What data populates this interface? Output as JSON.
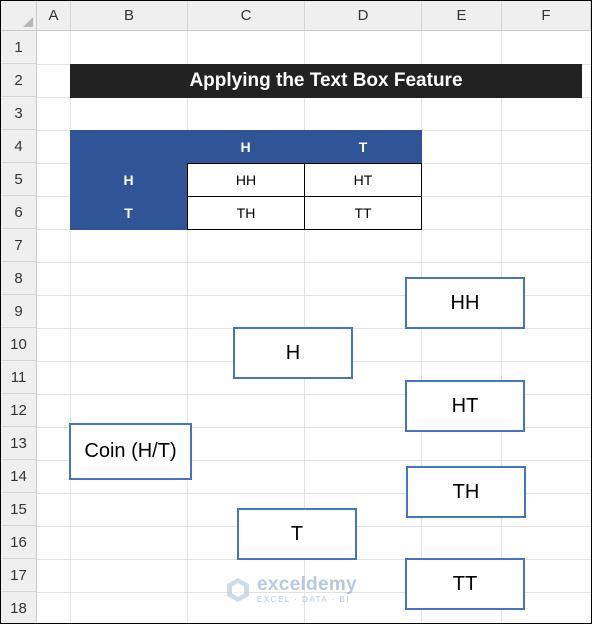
{
  "columns": [
    "A",
    "B",
    "C",
    "D",
    "E",
    "F"
  ],
  "rows": [
    "1",
    "2",
    "3",
    "4",
    "5",
    "6",
    "7",
    "8",
    "9",
    "10",
    "11",
    "12",
    "13",
    "14",
    "15",
    "16",
    "17",
    "18"
  ],
  "title": "Applying the Text Box Feature",
  "table": {
    "col_headers": [
      "H",
      "T"
    ],
    "rows": [
      {
        "header": "H",
        "cells": [
          "HH",
          "HT"
        ]
      },
      {
        "header": "T",
        "cells": [
          "TH",
          "TT"
        ]
      }
    ]
  },
  "text_boxes": {
    "coin": "Coin (H/T)",
    "h": "H",
    "t": "T",
    "hh": "HH",
    "ht": "HT",
    "th": "TH",
    "tt": "TT"
  },
  "watermark": {
    "name": "exceldemy",
    "tagline": "EXCEL · DATA · BI"
  },
  "colors": {
    "table_header": "#2f5597",
    "title_bg": "#222222",
    "textbox_border": "#4472c4"
  }
}
